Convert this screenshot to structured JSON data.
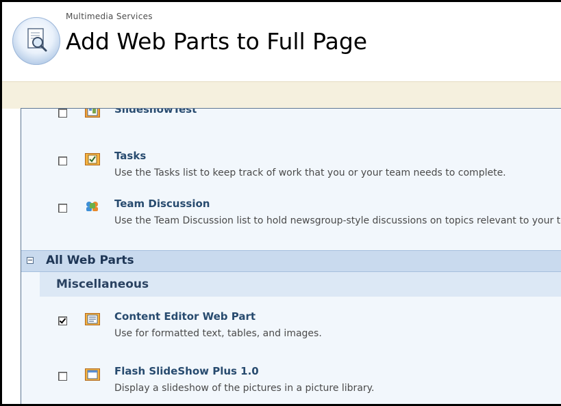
{
  "header": {
    "site_name": "Multimedia Services",
    "page_title": "Add Web Parts to Full Page"
  },
  "list_items_top": [
    {
      "title": "SlideshowTest",
      "description": "",
      "checked": false,
      "icon": "picture-library-icon"
    },
    {
      "title": "Tasks",
      "description": "Use the Tasks list to keep track of work that you or your team needs to complete.",
      "checked": false,
      "icon": "tasks-list-icon"
    },
    {
      "title": "Team Discussion",
      "description": "Use the Team Discussion list to hold newsgroup-style discussions on topics relevant to your team.",
      "checked": false,
      "icon": "discussion-board-icon"
    }
  ],
  "group": {
    "title": "All Web Parts",
    "collapse_glyph": "⊟"
  },
  "category": {
    "title": "Miscellaneous"
  },
  "web_parts": [
    {
      "title": "Content Editor Web Part",
      "description": "Use for formatted text, tables, and images.",
      "checked": true,
      "icon": "content-editor-icon"
    },
    {
      "title": "Flash SlideShow Plus 1.0",
      "description": "Display a slideshow of the pictures in a picture library.",
      "checked": false,
      "icon": "flash-slideshow-icon"
    }
  ],
  "colors": {
    "tan_bar": "#f5f0de",
    "panel_bg": "#f2f7fc",
    "group_header": "#c9daee",
    "category_header": "#dce8f5",
    "title_text": "#284b6f"
  }
}
